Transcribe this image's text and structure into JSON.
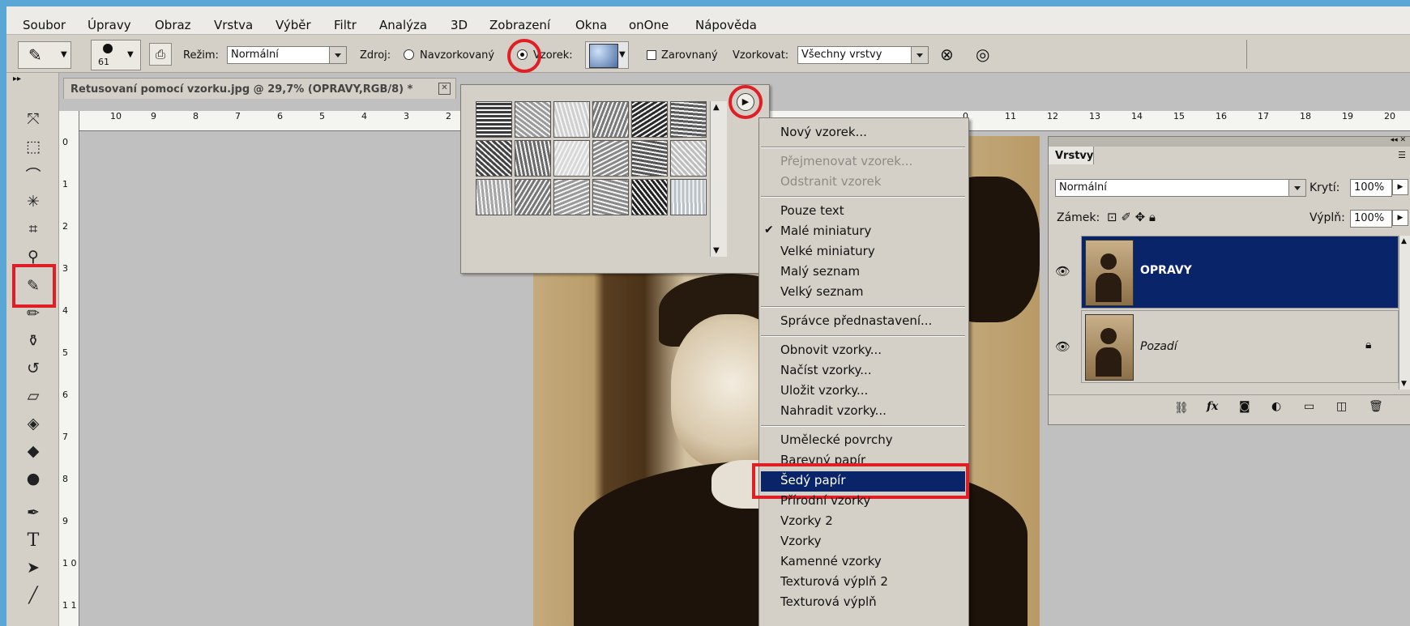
{
  "menu_bar": {
    "items": [
      "Soubor",
      "Úpravy",
      "Obraz",
      "Vrstva",
      "Výběr",
      "Filtr",
      "Analýza",
      "3D",
      "Zobrazení",
      "Okna",
      "onOne",
      "Nápověda"
    ]
  },
  "options_bar": {
    "brush_size": "61",
    "mode_label": "Režim:",
    "mode_value": "Normální",
    "source_label": "Zdroj:",
    "source_sampled": "Navzorkovaný",
    "source_pattern": "Vzorek:",
    "aligned_label": "Zarovnaný",
    "sample_label": "Vzorkovat:",
    "sample_value": "Všechny vrstvy"
  },
  "document": {
    "tab_title": "Retusovaní pomocí vzorku.jpg @ 29,7% (OPRAVY,RGB/8) *",
    "close_glyph": "✕"
  },
  "rulers": {
    "h_left": [
      "10",
      "9",
      "8",
      "7",
      "6",
      "5",
      "4",
      "3",
      "2"
    ],
    "h_right": [
      "0",
      "11",
      "12",
      "13",
      "14",
      "15",
      "16",
      "17",
      "18",
      "19",
      "20"
    ],
    "v": [
      "0",
      "1",
      "2",
      "3",
      "4",
      "5",
      "6",
      "7",
      "8",
      "9",
      "1 0",
      "1 1"
    ]
  },
  "pattern_menu": {
    "items": [
      {
        "label": "Nový vzorek...",
        "disabled": false
      },
      {
        "label": "Přejmenovat vzorek...",
        "disabled": true
      },
      {
        "label": "Odstranit vzorek",
        "disabled": true
      },
      {
        "label": "Pouze text",
        "disabled": false
      },
      {
        "label": "Malé miniatury",
        "disabled": false,
        "checked": true
      },
      {
        "label": "Velké miniatury",
        "disabled": false
      },
      {
        "label": "Malý seznam",
        "disabled": false
      },
      {
        "label": "Velký seznam",
        "disabled": false
      },
      {
        "label": "Správce přednastavení...",
        "disabled": false
      },
      {
        "label": "Obnovit vzorky...",
        "disabled": false
      },
      {
        "label": "Načíst vzorky...",
        "disabled": false
      },
      {
        "label": "Uložit vzorky...",
        "disabled": false
      },
      {
        "label": "Nahradit vzorky...",
        "disabled": false
      },
      {
        "label": "Umělecké povrchy",
        "disabled": false
      },
      {
        "label": "Barevný papír",
        "disabled": false
      },
      {
        "label": "Šedý papír",
        "disabled": false,
        "highlighted": true
      },
      {
        "label": "Přírodní vzorky",
        "disabled": false
      },
      {
        "label": "Vzorky 2",
        "disabled": false
      },
      {
        "label": "Vzorky",
        "disabled": false
      },
      {
        "label": "Kamenné vzorky",
        "disabled": false
      },
      {
        "label": "Texturová výplň 2",
        "disabled": false
      },
      {
        "label": "Texturová výplň",
        "disabled": false
      }
    ],
    "check_glyph": "✔"
  },
  "layers_panel": {
    "tab": "Vrstvy",
    "blend_mode": "Normální",
    "opacity_label": "Krytí:",
    "opacity_value": "100%",
    "lock_label": "Zámek:",
    "fill_label": "Výplň:",
    "fill_value": "100%",
    "layers": [
      {
        "name": "OPRAVY",
        "selected": true
      },
      {
        "name": "Pozadí",
        "selected": false,
        "locked": true
      }
    ],
    "footer_icons": [
      "link-icon",
      "fx-icon",
      "mask-icon",
      "adjustment-icon",
      "folder-icon",
      "new-layer-icon",
      "trash-icon"
    ]
  },
  "colors": {
    "highlight": "#0a246a",
    "annotation_red": "#e01e25"
  }
}
